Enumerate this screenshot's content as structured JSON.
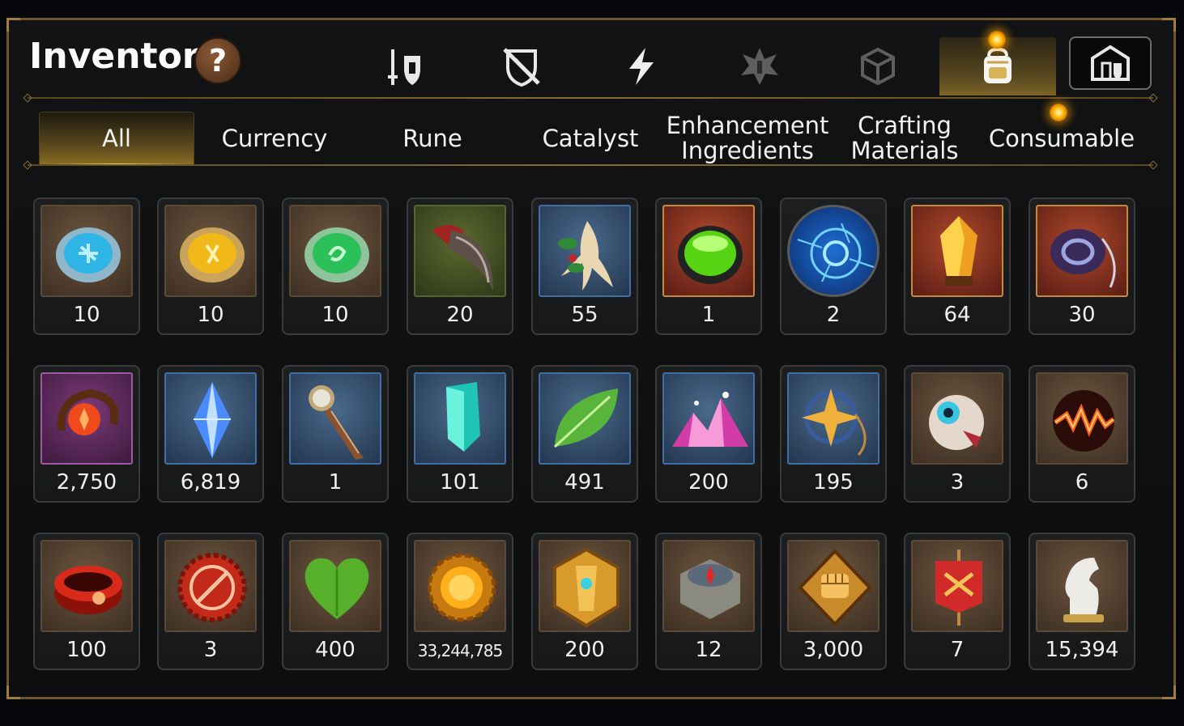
{
  "header": {
    "title": "Inventory",
    "help_label": "?"
  },
  "category_tabs": [
    {
      "name": "equipment",
      "icon": "sword-shield-icon",
      "active": false
    },
    {
      "name": "unequip",
      "icon": "broken-shield-icon",
      "active": false
    },
    {
      "name": "boost",
      "icon": "lightning-icon",
      "active": false
    },
    {
      "name": "skill",
      "icon": "rune-star-icon",
      "active": false
    },
    {
      "name": "crates",
      "icon": "cube-icon",
      "active": false
    },
    {
      "name": "bag",
      "icon": "backpack-icon",
      "active": true
    },
    {
      "name": "guild",
      "icon": "castle-gate-icon",
      "active": false
    }
  ],
  "sub_tabs": [
    {
      "label": "All",
      "active": true
    },
    {
      "label": "Currency",
      "active": false
    },
    {
      "label": "Rune",
      "active": false
    },
    {
      "label": "Catalyst",
      "active": false
    },
    {
      "label": "Enhancement Ingredients",
      "line1": "Enhancement",
      "line2": "Ingredients",
      "active": false
    },
    {
      "label": "Crafting Materials",
      "line1": "Crafting",
      "line2": "Materials",
      "active": false
    },
    {
      "label": "Consumable",
      "active": false
    }
  ],
  "items": [
    {
      "icon": "blue-rune-stone-icon",
      "quantity": "10"
    },
    {
      "icon": "yellow-rune-stone-icon",
      "quantity": "10"
    },
    {
      "icon": "green-rune-stone-icon",
      "quantity": "10"
    },
    {
      "icon": "claw-icon",
      "quantity": "20"
    },
    {
      "icon": "ginseng-root-icon",
      "quantity": "55"
    },
    {
      "icon": "green-orb-icon",
      "quantity": "1"
    },
    {
      "icon": "blue-portal-icon",
      "quantity": "2"
    },
    {
      "icon": "amber-crystal-icon",
      "quantity": "64"
    },
    {
      "icon": "pendant-ring-icon",
      "quantity": "30"
    },
    {
      "icon": "orange-flower-ring-icon",
      "quantity": "2,750"
    },
    {
      "icon": "blue-crystal-icon",
      "quantity": "6,819"
    },
    {
      "icon": "pocket-watch-dagger-icon",
      "quantity": "1"
    },
    {
      "icon": "teal-crystal-icon",
      "quantity": "101"
    },
    {
      "icon": "green-leaf-icon",
      "quantity": "491"
    },
    {
      "icon": "pink-crystal-pile-icon",
      "quantity": "200"
    },
    {
      "icon": "star-amulet-icon",
      "quantity": "195"
    },
    {
      "icon": "eyeball-device-icon",
      "quantity": "3"
    },
    {
      "icon": "fire-orb-icon",
      "quantity": "6"
    },
    {
      "icon": "red-bracelet-icon",
      "quantity": "100"
    },
    {
      "icon": "red-seal-badge-icon",
      "quantity": "3"
    },
    {
      "icon": "green-heart-icon",
      "quantity": "400"
    },
    {
      "icon": "gold-sun-coin-icon",
      "quantity": "33,244,785"
    },
    {
      "icon": "hexagon-gold-badge-icon",
      "quantity": "200"
    },
    {
      "icon": "stone-compass-icon",
      "quantity": "12"
    },
    {
      "icon": "fist-emblem-icon",
      "quantity": "3,000"
    },
    {
      "icon": "war-banner-icon",
      "quantity": "7"
    },
    {
      "icon": "chess-knight-icon",
      "quantity": "15,394"
    }
  ]
}
